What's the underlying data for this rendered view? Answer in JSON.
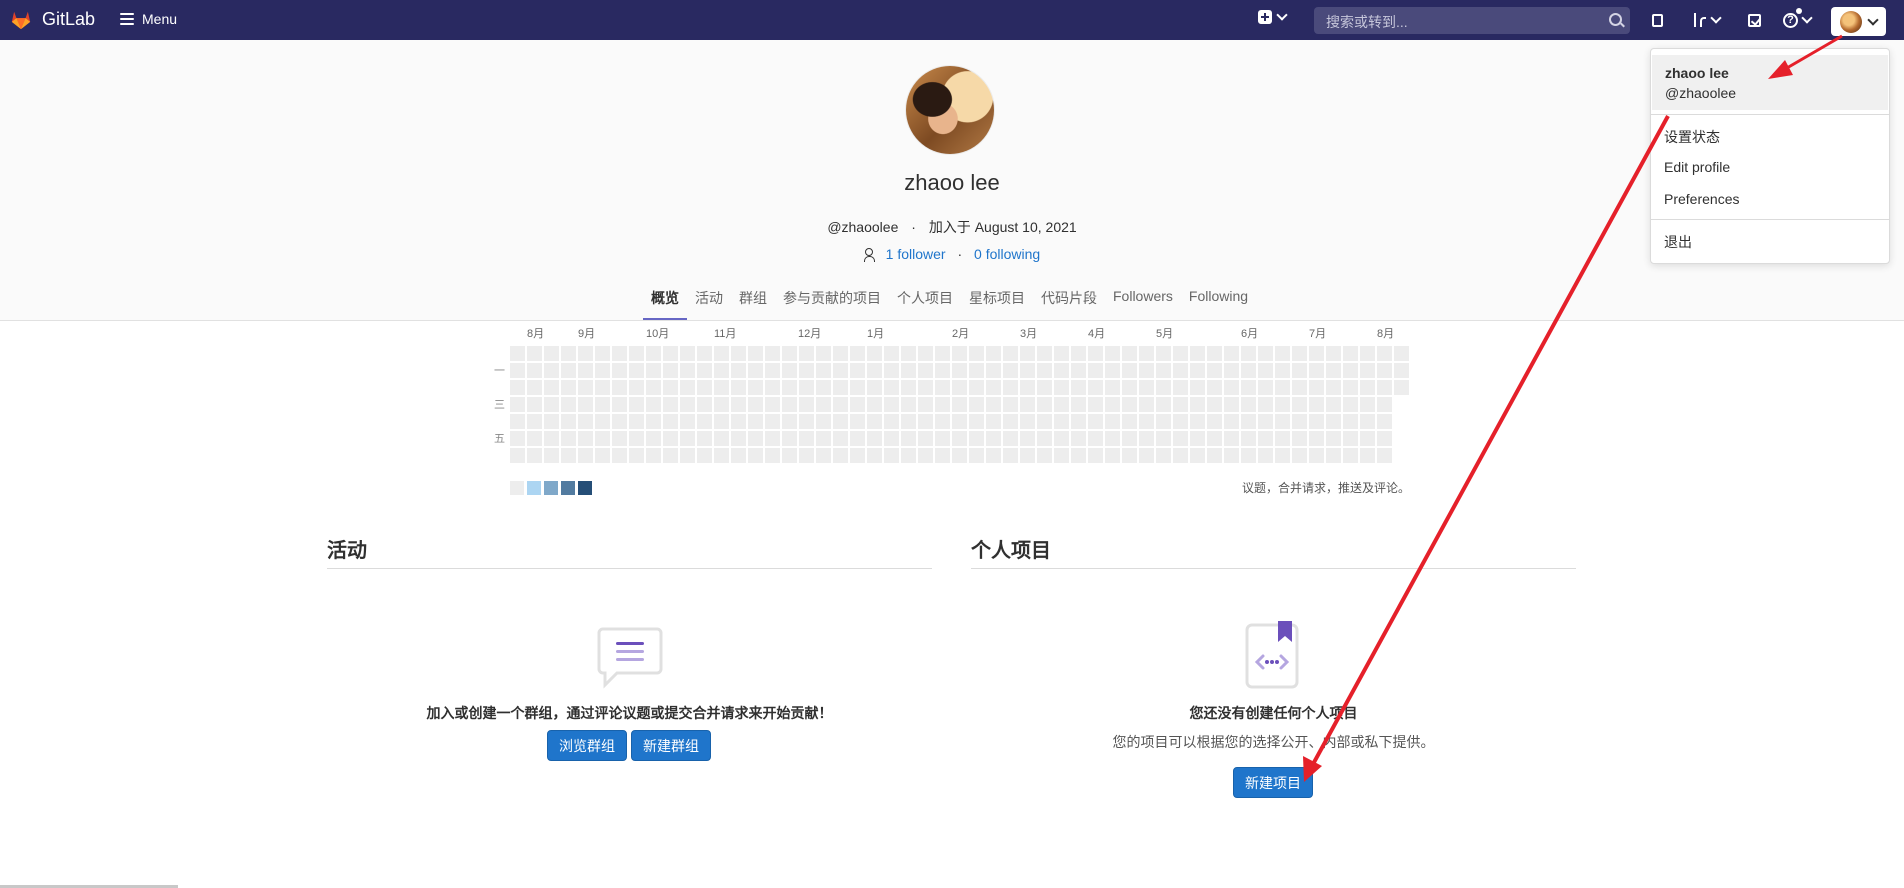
{
  "navbar": {
    "brand": "GitLab",
    "menu_label": "Menu",
    "search_placeholder": "搜索或转到..."
  },
  "profile": {
    "name": "zhaoo lee",
    "handle": "@zhaoolee",
    "joined": "加入于 August 10, 2021",
    "followers": "1 follower",
    "following": "0 following"
  },
  "tabs": [
    "概览",
    "活动",
    "群组",
    "参与贡献的项目",
    "个人项目",
    "星标项目",
    "代码片段",
    "Followers",
    "Following"
  ],
  "calendar": {
    "months": [
      "8月",
      "9月",
      "10月",
      "11月",
      "12月",
      "1月",
      "2月",
      "3月",
      "4月",
      "5月",
      "6月",
      "7月",
      "8月"
    ],
    "day_labels": [
      "一",
      "三",
      "五"
    ],
    "legend_text": "议题，合并请求，推送及评论。",
    "legend_colors": [
      "#ededed",
      "#acd5f2",
      "#7fa8c9",
      "#527ba0",
      "#254e77"
    ]
  },
  "activity": {
    "title": "活动",
    "empty_text": "加入或创建一个群组，通过评论议题或提交合并请求来开始贡献！",
    "browse_groups": "浏览群组",
    "new_group": "新建群组"
  },
  "projects": {
    "title": "个人项目",
    "empty_title": "您还没有创建任何个人项目",
    "empty_text": "您的项目可以根据您的选择公开、内部或私下提供。",
    "new_project": "新建项目"
  },
  "dropdown": {
    "name": "zhaoo lee",
    "handle": "@zhaoolee",
    "set_status": "设置状态",
    "edit_profile": "Edit profile",
    "preferences": "Preferences",
    "sign_out": "退出"
  },
  "colors": {
    "navbar_bg": "#292961",
    "accent_blue": "#1f75cb",
    "tab_underline": "#6666c4",
    "annotation_red": "#e5202a"
  }
}
